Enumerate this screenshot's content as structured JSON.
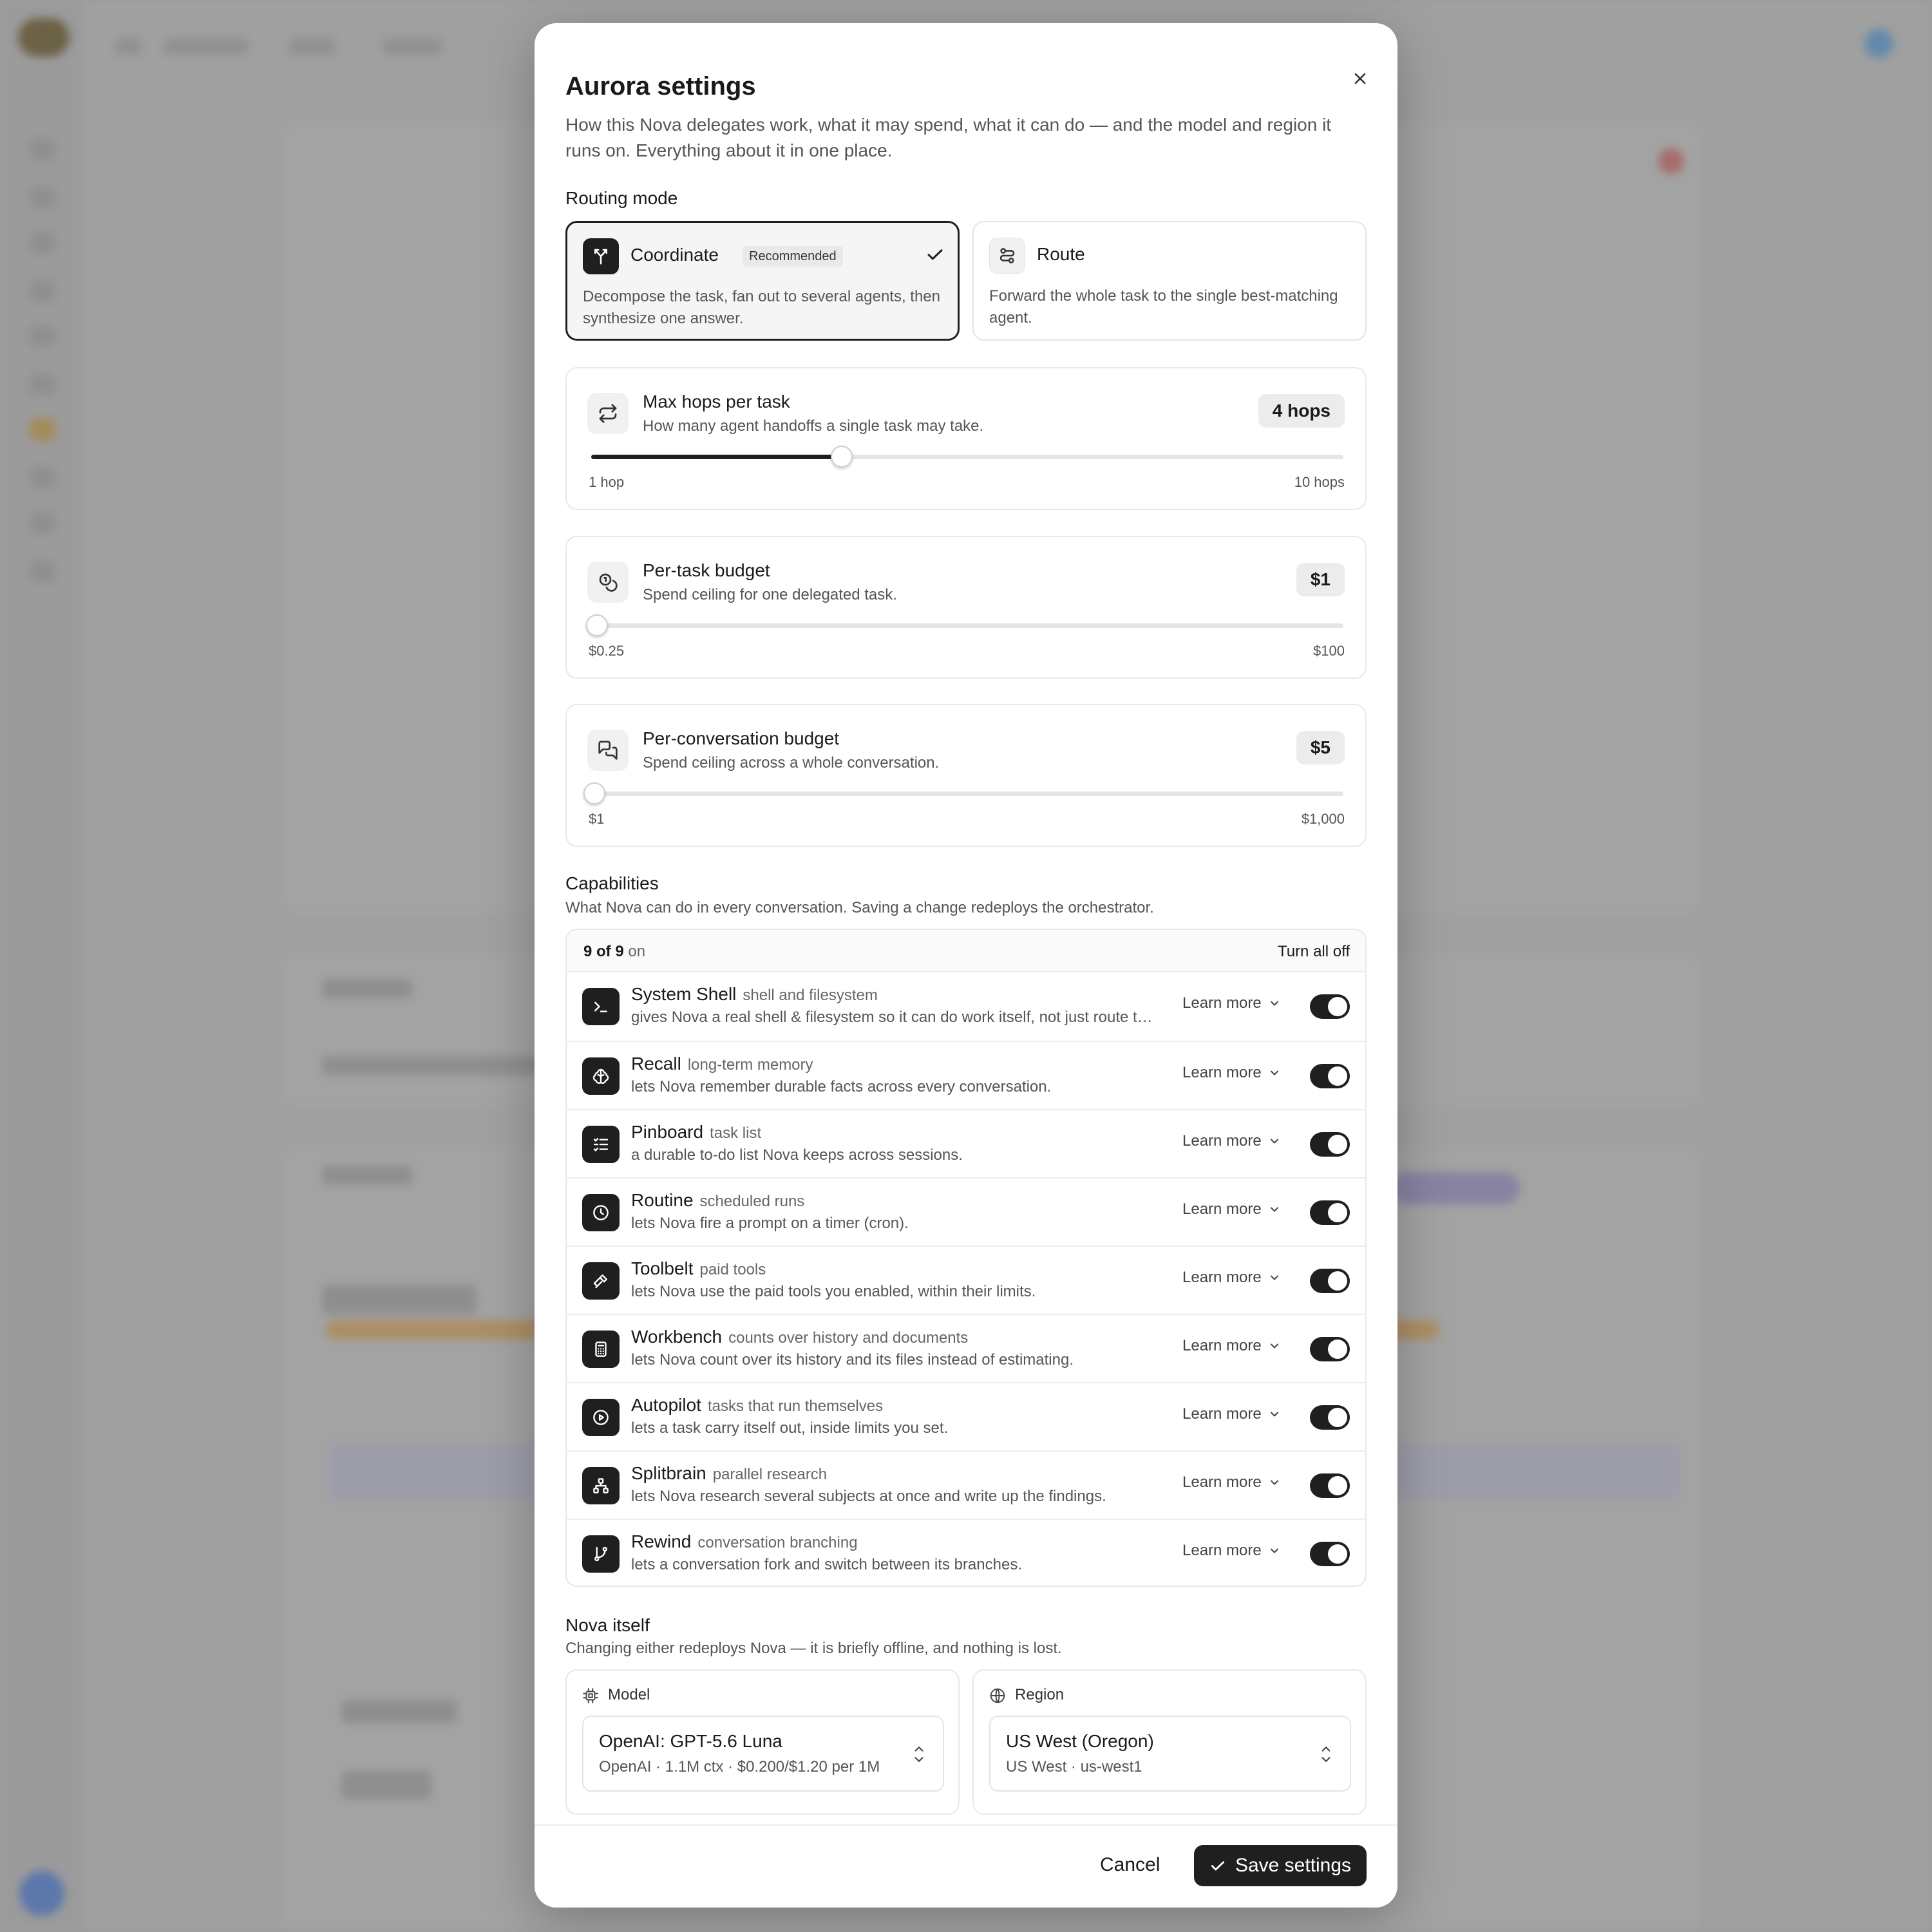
{
  "modal": {
    "title": "Aurora settings",
    "subtitle": "How this Nova delegates work, what it may spend, what it can do — and the model and region it runs on. Everything about it in one place."
  },
  "routing": {
    "label": "Routing mode",
    "options": [
      {
        "title": "Coordinate",
        "badge": "Recommended",
        "desc": "Decompose the task, fan out to several agents, then synthesize one answer.",
        "selected": true,
        "icon": "fan-out-icon"
      },
      {
        "title": "Route",
        "desc": "Forward the whole task to the single best-matching agent.",
        "selected": false,
        "icon": "route-icon"
      }
    ]
  },
  "sliders": {
    "hops": {
      "title": "Max hops per task",
      "desc": "How many agent handoffs a single task may take.",
      "value_label": "4  hops",
      "min_label": "1 hop",
      "max_label": "10 hops",
      "value": 4,
      "min": 1,
      "max": 10,
      "icon": "repeat-icon"
    },
    "task_budget": {
      "title": "Per-task budget",
      "desc": "Spend ceiling for one delegated task.",
      "value_label": "$1",
      "min_label": "$0.25",
      "max_label": "$100",
      "value": 1,
      "min": 0.25,
      "max": 100,
      "icon": "coins-icon"
    },
    "conv_budget": {
      "title": "Per-conversation budget",
      "desc": "Spend ceiling across a whole conversation.",
      "value_label": "$5",
      "min_label": "$1",
      "max_label": "$1,000",
      "value": 5,
      "min": 1,
      "max": 1000,
      "icon": "chat-icon"
    }
  },
  "capabilities": {
    "label": "Capabilities",
    "sub": "What Nova can do in every conversation. Saving a change redeploys the orchestrator.",
    "count_bold": "9 of 9",
    "count_rest": "on",
    "turn_all_off": "Turn all off",
    "learn_more": "Learn more",
    "items": [
      {
        "name": "System Shell",
        "tag": "shell and filesystem",
        "desc": "gives Nova a real shell & filesystem so it can do work itself, not just route to agents.",
        "on": true,
        "icon": "terminal-icon"
      },
      {
        "name": "Recall",
        "tag": "long-term memory",
        "desc": "lets Nova remember durable facts across every conversation.",
        "on": true,
        "icon": "brain-icon"
      },
      {
        "name": "Pinboard",
        "tag": "task list",
        "desc": "a durable to-do list Nova keeps across sessions.",
        "on": true,
        "icon": "checklist-icon"
      },
      {
        "name": "Routine",
        "tag": "scheduled runs",
        "desc": "lets Nova fire a prompt on a timer (cron).",
        "on": true,
        "icon": "clock-icon"
      },
      {
        "name": "Toolbelt",
        "tag": "paid tools",
        "desc": "lets Nova use the paid tools you enabled, within their limits.",
        "on": true,
        "icon": "hammer-icon"
      },
      {
        "name": "Workbench",
        "tag": "counts over history and documents",
        "desc": "lets Nova count over its history and its files instead of estimating.",
        "on": true,
        "icon": "calculator-icon"
      },
      {
        "name": "Autopilot",
        "tag": "tasks that run themselves",
        "desc": "lets a task carry itself out, inside limits you set.",
        "on": true,
        "icon": "play-circle-icon"
      },
      {
        "name": "Splitbrain",
        "tag": "parallel research",
        "desc": "lets Nova research several subjects at once and write up the findings.",
        "on": true,
        "icon": "network-icon"
      },
      {
        "name": "Rewind",
        "tag": "conversation branching",
        "desc": "lets a conversation fork and switch between its branches.",
        "on": true,
        "icon": "git-branch-icon"
      }
    ]
  },
  "nova": {
    "label": "Nova itself",
    "sub": "Changing either redeploys Nova — it is briefly offline, and nothing is lost.",
    "model": {
      "label": "Model",
      "value": "OpenAI: GPT-5.6 Luna",
      "sub": "OpenAI  ·  1.1M ctx  ·  $0.200/$1.20 per 1M",
      "icon": "chip-icon"
    },
    "region": {
      "label": "Region",
      "value": "US West (Oregon)",
      "sub": "US West · us-west1",
      "icon": "globe-icon"
    }
  },
  "footer": {
    "cancel": "Cancel",
    "save": "Save settings"
  }
}
